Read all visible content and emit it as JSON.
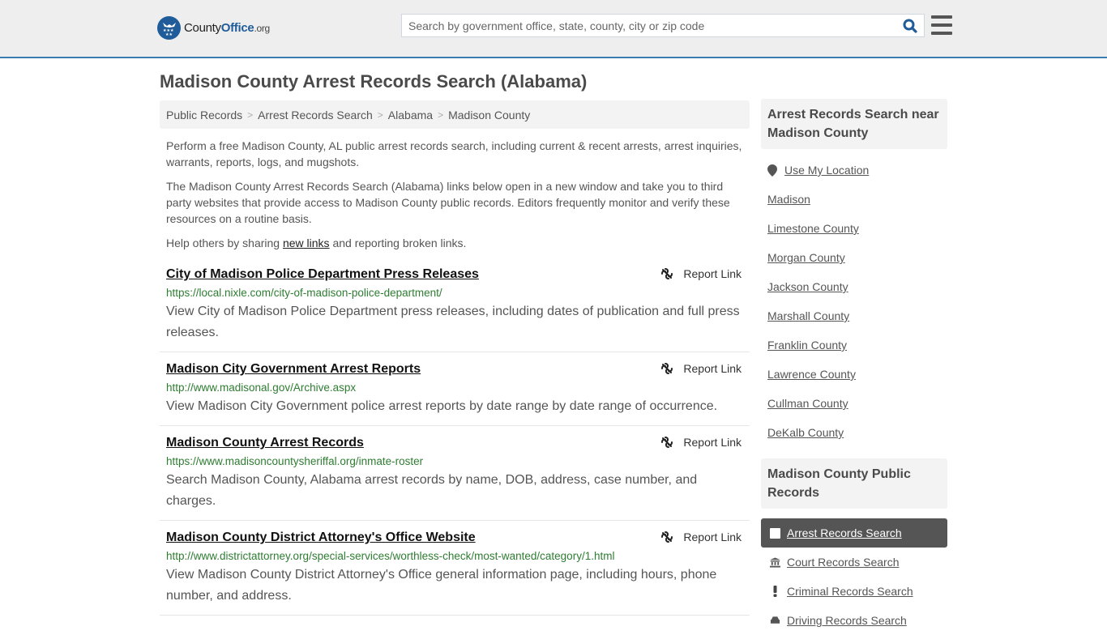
{
  "header": {
    "logo": {
      "county": "County",
      "office": "Office",
      "org": ".org"
    },
    "search": {
      "placeholder": "Search by government office, state, county, city or zip code",
      "value": ""
    }
  },
  "page_title": "Madison County Arrest Records Search (Alabama)",
  "breadcrumb": [
    {
      "label": "Public Records"
    },
    {
      "label": "Arrest Records Search"
    },
    {
      "label": "Alabama"
    },
    {
      "label": "Madison County"
    }
  ],
  "breadcrumb_separator": ">",
  "intro": {
    "p1": "Perform a free Madison County, AL public arrest records search, including current & recent arrests, arrest inquiries, warrants, reports, logs, and mugshots.",
    "p2": "The Madison County Arrest Records Search (Alabama) links below open in a new window and take you to third party websites that provide access to Madison County public records. Editors frequently monitor and verify these resources on a routine basis.",
    "p3_before": "Help others by sharing ",
    "p3_link": "new links",
    "p3_after": " and reporting broken links."
  },
  "report_label": "Report Link",
  "results": [
    {
      "title": "City of Madison Police Department Press Releases",
      "url": "https://local.nixle.com/city-of-madison-police-department/",
      "desc": "View City of Madison Police Department press releases, including dates of publication and full press releases."
    },
    {
      "title": "Madison City Government Arrest Reports",
      "url": "http://www.madisonal.gov/Archive.aspx",
      "desc": "View Madison City Government police arrest reports by date range by date range of occurrence."
    },
    {
      "title": "Madison County Arrest Records",
      "url": "https://www.madisoncountysheriffal.org/inmate-roster",
      "desc": "Search Madison County, Alabama arrest records by name, DOB, address, case number, and charges."
    },
    {
      "title": "Madison County District Attorney's Office Website",
      "url": "http://www.districtattorney.org/special-services/worthless-check/most-wanted/category/1.html",
      "desc": "View Madison County District Attorney's Office general information page, including hours, phone number, and address."
    }
  ],
  "sidebar": {
    "nearby_heading": "Arrest Records Search near Madison County",
    "use_location": "Use My Location",
    "nearby": [
      "Madison",
      "Limestone County",
      "Morgan County",
      "Jackson County",
      "Marshall County",
      "Franklin County",
      "Lawrence County",
      "Cullman County",
      "DeKalb County"
    ],
    "public_records_heading": "Madison County Public Records",
    "public_records": [
      {
        "label": "Arrest Records Search",
        "icon": "square-icon",
        "active": true
      },
      {
        "label": "Court Records Search",
        "icon": "courthouse-icon",
        "active": false
      },
      {
        "label": "Criminal Records Search",
        "icon": "exclamation-icon",
        "active": false
      },
      {
        "label": "Driving Records Search",
        "icon": "car-icon",
        "active": false
      }
    ]
  },
  "colors": {
    "brand_blue": "#1f5c99",
    "header_bg": "#eeeeee",
    "header_border": "#3a7bb0",
    "url_green": "#2e7d32",
    "active_item_bg": "#555555"
  }
}
